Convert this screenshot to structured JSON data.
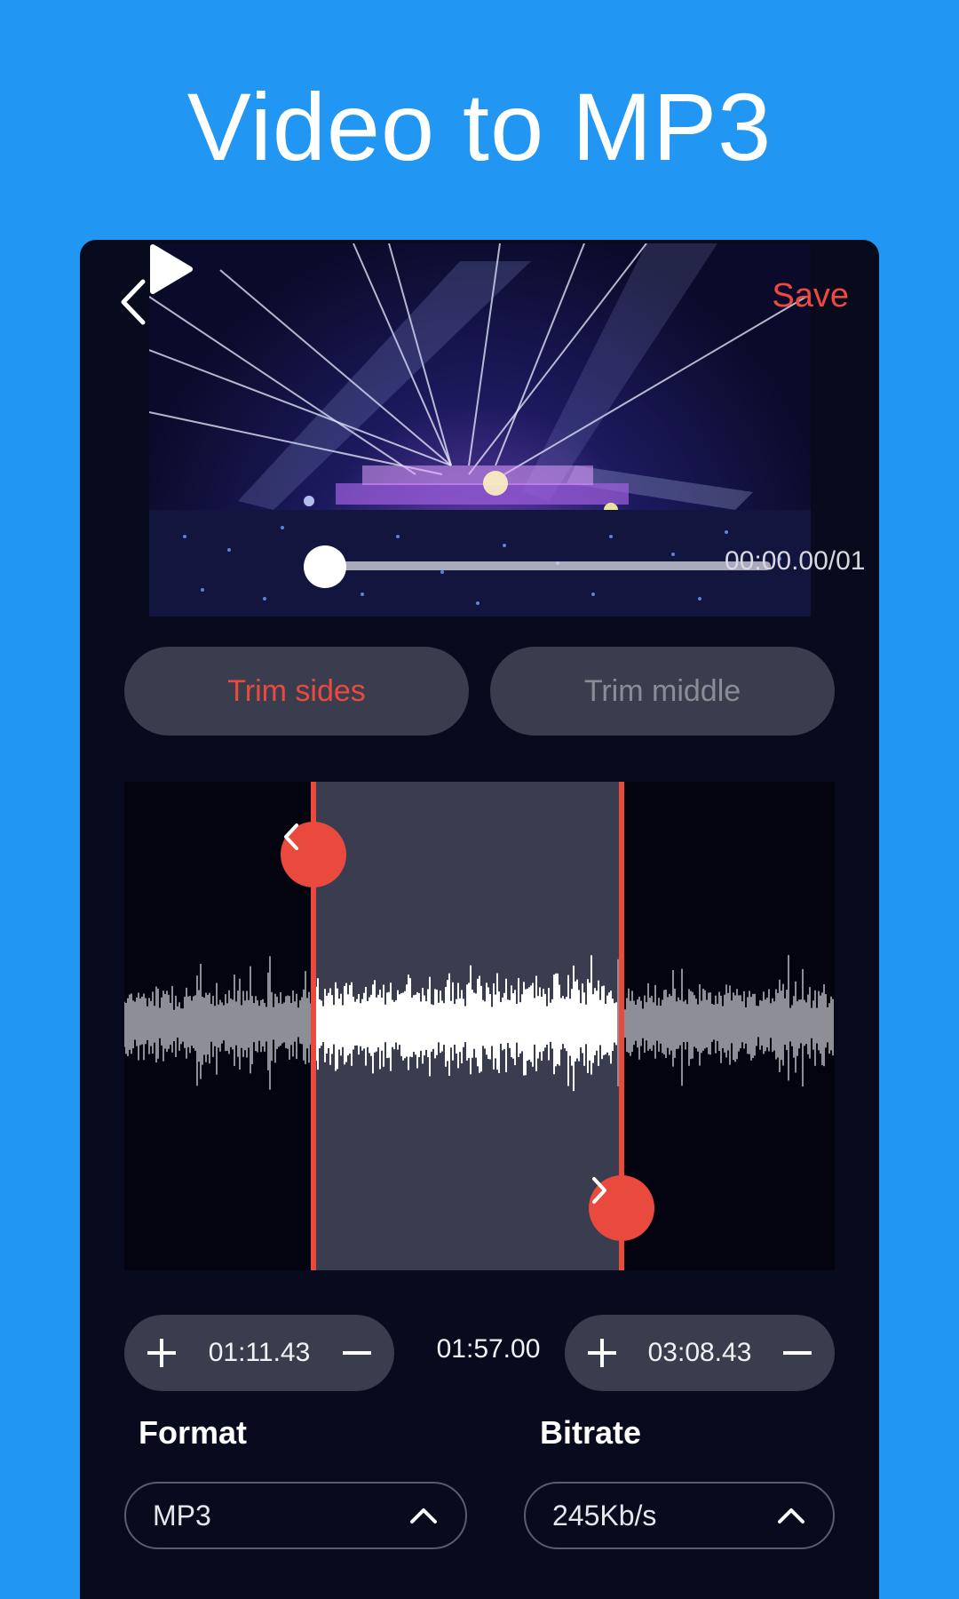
{
  "headline": "Video to MP3",
  "header": {
    "save_label": "Save"
  },
  "player": {
    "time_readout": "00:00.00/01",
    "progress": 0.0
  },
  "modes": {
    "trim_sides": "Trim sides",
    "trim_middle": "Trim middle",
    "active": "trim_sides"
  },
  "trim": {
    "start": "01:11.43",
    "duration": "01:57.00",
    "end": "03:08.43"
  },
  "format": {
    "label": "Format",
    "value": "MP3"
  },
  "bitrate": {
    "label": "Bitrate",
    "value": "245Kb/s"
  },
  "colors": {
    "background": "#2196F3",
    "accent": "#ea4a3e",
    "panel": "#080a1e"
  },
  "icons": [
    "chevron-left-icon",
    "play-icon",
    "plus-icon",
    "minus-icon",
    "chevron-up-icon",
    "chevron-right-icon"
  ]
}
